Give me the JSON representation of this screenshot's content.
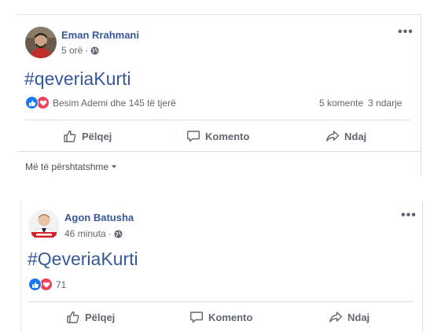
{
  "posts": [
    {
      "author": "Eman Rrahmani",
      "time": "5 orë",
      "separator": "·",
      "hashtag": "#qeveriaKurti",
      "reactions_text": "Besim Ademi dhe 145 të tjerë",
      "comments": "5 komente",
      "shares": "3 ndarje",
      "actions": {
        "like": "Pëlqej",
        "comment": "Komento",
        "share": "Ndaj"
      },
      "sort_label": "Më të përshtatshme"
    },
    {
      "author": "Agon Batusha",
      "time": "46 minuta",
      "separator": "·",
      "hashtag": "#QeveriaKurti",
      "reactions_text": "71",
      "actions": {
        "like": "Pëlqej",
        "comment": "Komento",
        "share": "Ndaj"
      }
    }
  ],
  "more_glyph": "•••",
  "colors": {
    "link": "#385898",
    "like": "#1877f2",
    "love": "#f33e58",
    "muted": "#606770"
  },
  "icons": [
    "globe-icon",
    "more-options-icon",
    "like-reaction-icon",
    "love-reaction-icon",
    "thumbs-up-icon",
    "comment-icon",
    "share-icon",
    "caret-down-icon"
  ]
}
